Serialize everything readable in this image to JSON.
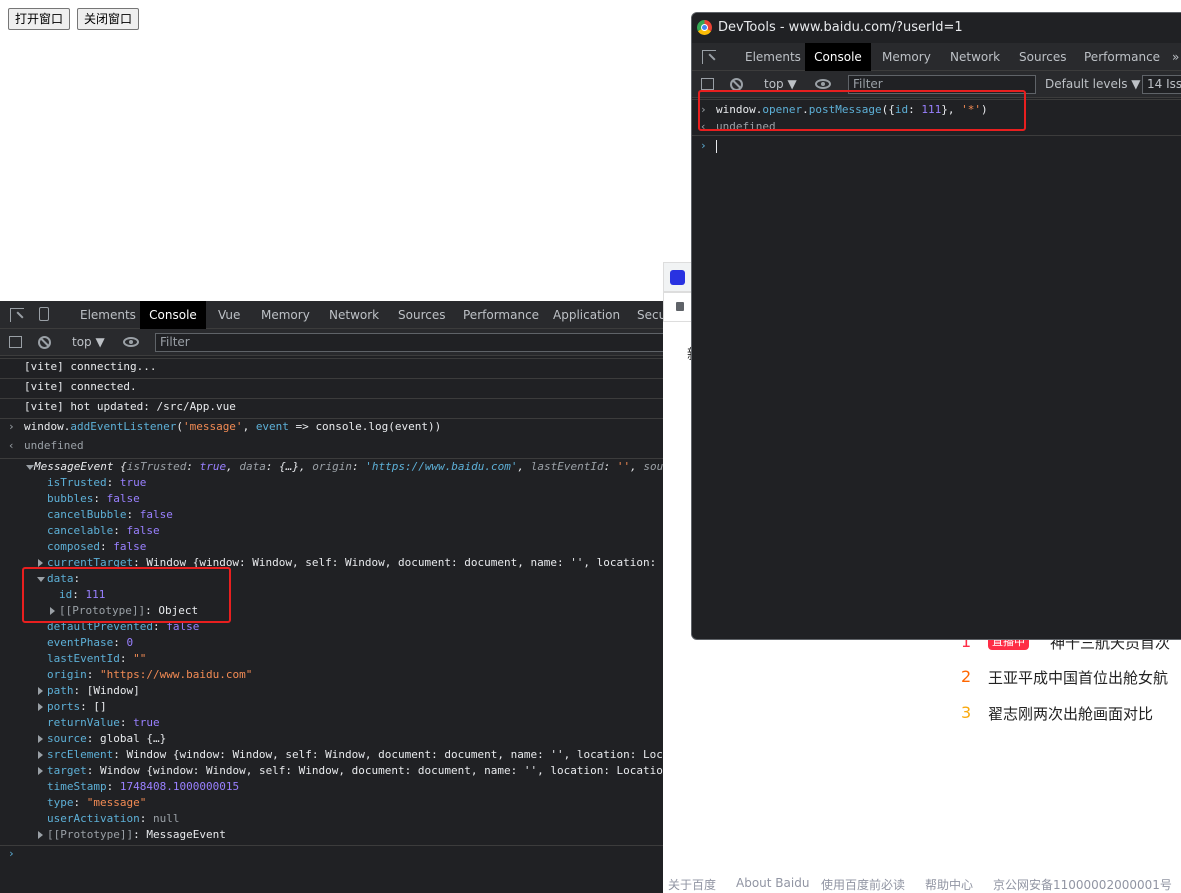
{
  "page": {
    "open_button": "打开窗口",
    "close_button": "关闭窗口"
  },
  "bottom_devtools": {
    "tabs": [
      "Elements",
      "Console",
      "Vue",
      "Memory",
      "Network",
      "Sources",
      "Performance",
      "Application",
      "Secu"
    ],
    "active_tab": "Console",
    "context": "top ▼",
    "filter_placeholder": "Filter",
    "log_lines": [
      "[vite] connecting...",
      "[vite] connected.",
      "[vite] hot updated: /src/App.vue"
    ],
    "command": {
      "prefix": "window.",
      "method": "addEventListener",
      "open": "(",
      "event_str": "'message'",
      "comma": ", ",
      "param": "event",
      "arrow": " => ",
      "body": "console.log(event))"
    },
    "result": "undefined",
    "event_summary": {
      "name": "MessageEvent",
      "text1": " {",
      "k1": "isTrusted",
      "v1": "true",
      "k2": "data",
      "v2": "{…}",
      "k3": "origin",
      "v3": "'https://www.baidu.com'",
      "k4": "lastEventId",
      "v4": "''",
      "k5": "sou"
    },
    "props": [
      {
        "key": "isTrusted",
        "value": "true",
        "type": "bool"
      },
      {
        "key": "bubbles",
        "value": "false",
        "type": "bool"
      },
      {
        "key": "cancelBubble",
        "value": "false",
        "type": "bool"
      },
      {
        "key": "cancelable",
        "value": "false",
        "type": "bool"
      },
      {
        "key": "composed",
        "value": "false",
        "type": "bool"
      }
    ],
    "current_target": {
      "key": "currentTarget",
      "value": "Window {window: Window, self: Window, document: document, name: '', location: L"
    },
    "data_prop": {
      "key": "data",
      "id_key": "id",
      "id_value": "111",
      "proto_key": "[[Prototype]]",
      "proto_value": "Object"
    },
    "props2": [
      {
        "key": "defaultPrevented",
        "value": "false",
        "type": "bool"
      },
      {
        "key": "eventPhase",
        "value": "0",
        "type": "num"
      },
      {
        "key": "lastEventId",
        "value": "\"\"",
        "type": "str"
      },
      {
        "key": "origin",
        "value": "\"https://www.baidu.com\"",
        "type": "str"
      }
    ],
    "path": {
      "key": "path",
      "value": "[Window]"
    },
    "ports": {
      "key": "ports",
      "value": "[]"
    },
    "returnValue": {
      "key": "returnValue",
      "value": "true"
    },
    "source": {
      "key": "source",
      "value": "global {…}"
    },
    "srcElement": {
      "key": "srcElement",
      "value": "Window {window: Window, self: Window, document: document, name: '', location: Loca"
    },
    "target": {
      "key": "target",
      "value": "Window {window: Window, self: Window, document: document, name: '', location: Location"
    },
    "timeStamp": {
      "key": "timeStamp",
      "value": "1748408.1000000015"
    },
    "type_prop": {
      "key": "type",
      "value": "\"message\""
    },
    "userActivation": {
      "key": "userActivation",
      "value": "null"
    },
    "proto": {
      "key": "[[Prototype]]",
      "value": "MessageEvent"
    }
  },
  "top_devtools": {
    "title": "DevTools - www.baidu.com/?userId=1",
    "tabs": [
      "Elements",
      "Console",
      "Memory",
      "Network",
      "Sources",
      "Performance"
    ],
    "more": "»",
    "active_tab": "Console",
    "context": "top ▼",
    "filter_placeholder": "Filter",
    "levels": "Default levels ▼",
    "issues": "14 Iss",
    "command": {
      "p1": "window.",
      "p2": "opener",
      "p3": ".",
      "p4": "postMessage",
      "p5": "({",
      "p6": "id",
      "p7": ": ",
      "p8": "111",
      "p9": "}, ",
      "p10": "'*'",
      "p11": ")"
    },
    "result": "undefined"
  },
  "baidu": {
    "hot_items": [
      {
        "num": "1",
        "badge": "直播中",
        "text": "神十三航天员首次"
      },
      {
        "num": "2",
        "text": "王亚平成中国首位出舱女航"
      },
      {
        "num": "3",
        "text": "翟志刚两次出舱画面对比"
      }
    ],
    "side_char": "新",
    "footer": [
      "关于百度",
      "About Baidu",
      "使用百度前必读",
      "帮助中心",
      "京公网安备11000002000001号"
    ],
    "colors": {
      "num1": "#fe2d46",
      "num2": "#ff6600",
      "num3": "#faa90e"
    }
  }
}
